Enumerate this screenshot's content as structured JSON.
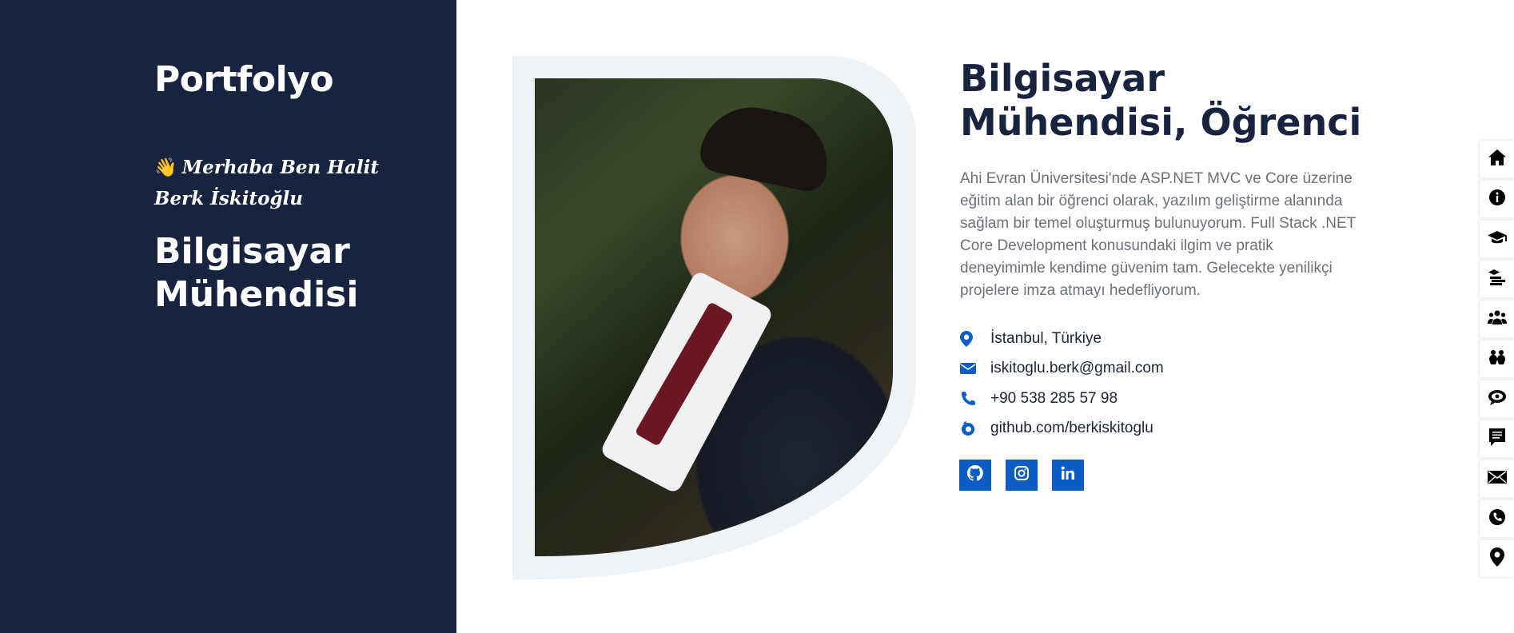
{
  "sidebar": {
    "brand": "Portfolyo",
    "greeting_emoji": "👋",
    "greeting": "Merhaba Ben Halit Berk İskitoğlu",
    "role": "Bilgisayar Mühendisi"
  },
  "main": {
    "headline": "Bilgisayar Mühendisi, Öğrenci",
    "description": "Ahi Evran Üniversitesi'nde ASP.NET MVC ve Core üzerine eğitim alan bir öğrenci olarak, yazılım geliştirme alanında sağlam bir temel oluşturmuş bulunuyorum. Full Stack .NET Core Development konusundaki ilgim ve pratik deneyimimle kendime güvenim tam. Gelecekte yenilikçi projelere imza atmayı hedefliyorum.",
    "contact": {
      "location": "İstanbul, Türkiye",
      "email": "iskitoglu.berk@gmail.com",
      "phone": "+90 538 285 57 98",
      "website": "github.com/berkiskitoglu"
    },
    "socials": [
      "github-icon",
      "instagram-icon",
      "linkedin-icon"
    ]
  },
  "right_nav": [
    "home-icon",
    "info-icon",
    "graduation-cap-icon",
    "education-icon",
    "team-icon",
    "people-icon",
    "chat-icon",
    "portfolio-icon",
    "mail-icon",
    "phone-icon",
    "location-icon"
  ],
  "colors": {
    "sidebar_bg": "#18233f",
    "accent": "#0b5cc4",
    "heading": "#18233f",
    "text_muted": "#6c7177"
  }
}
